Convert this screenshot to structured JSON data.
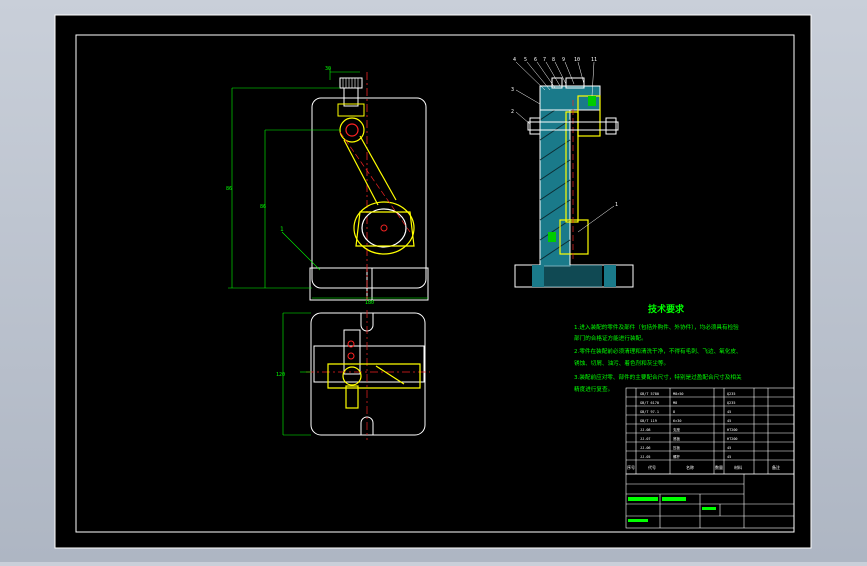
{
  "drawing": {
    "tech_requirements": {
      "title": "技术要求",
      "lines": [
        "1.进入装配的零件及部件（包括外购件、外协件），均必须具有检验",
        "部门的合格证方能进行装配。",
        "2.零件在装配前必须清理和清洗干净，不得有毛刺、飞边、氧化皮、",
        "锈蚀、切屑、油污、着色剂和灰尘等。",
        "3.装配前应对零、部件的主要配合尺寸，特别是过盈配合尺寸及相关",
        "精度进行复查。"
      ]
    },
    "callouts": {
      "top": [
        "4",
        "5",
        "6",
        "7",
        "8",
        "9",
        "10",
        "11"
      ],
      "left": [
        "3",
        "2"
      ],
      "right": [
        "1"
      ],
      "front": [
        "1"
      ]
    },
    "title_block": {
      "header_seq": "序号",
      "header_code": "代号",
      "header_name": "名称",
      "header_qty": "数量",
      "header_material": "材料",
      "header_note": "备注"
    }
  }
}
